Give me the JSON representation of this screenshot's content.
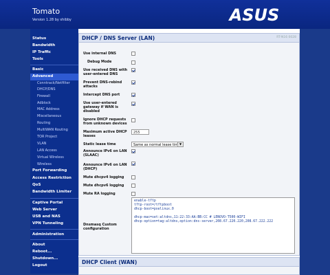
{
  "app": {
    "title": "Tomato",
    "version": "Version 1.28 by shibby",
    "brand": "ASUS",
    "build": "RT-N16 0028"
  },
  "sidebar": {
    "group1": [
      "Status",
      "Bandwidth",
      "IP Traffic",
      "Tools"
    ],
    "basic": "Basic",
    "advanced": "Advanced",
    "advanced_items": [
      "Conntrack/Netfilter",
      "DHCP/DNS",
      "Firewall",
      "Adblock",
      "MAC Address",
      "Miscellaneous",
      "Routing",
      "MultiWAN Routing",
      "TOR Project",
      "VLAN",
      "LAN Access",
      "Virtual Wireless",
      "Wireless"
    ],
    "group2": [
      "Port Forwarding",
      "Access Restriction",
      "QoS",
      "Bandwidth Limiter"
    ],
    "group3": [
      "Captive Portal",
      "Web Server",
      "USB and NAS",
      "VPN Tunneling"
    ],
    "administration": "Administration",
    "group4": [
      "About",
      "Reboot...",
      "Shutdown...",
      "Logout"
    ]
  },
  "dhcp_server": {
    "title": "DHCP / DNS Server (LAN)",
    "fields": [
      {
        "label": "Use internal DNS",
        "checked": false
      },
      {
        "label": "Debug Mode",
        "checked": false
      },
      {
        "label": "Use received DNS with user-entered DNS",
        "checked": true
      },
      {
        "label": "Prevent DNS-rebind attacks",
        "checked": true
      },
      {
        "label": "Intercept DNS port",
        "checked": true
      },
      {
        "label": "Use user-entered gateway if WAN is disabled",
        "checked": true
      },
      {
        "label": "Ignore DHCP requests from unknown devices",
        "checked": false
      }
    ],
    "max_leases_label": "Maximum active DHCP leases",
    "max_leases_value": "255",
    "static_lease_label": "Static lease time",
    "static_lease_value": "Same as normal lease time",
    "fields2": [
      {
        "label": "Announce IPv6 on LAN (SLAAC)",
        "checked": true
      },
      {
        "label": "Announce IPv6 on LAN (DHCP)",
        "checked": true
      },
      {
        "label": "Mute dhcpv4 logging",
        "checked": false
      },
      {
        "label": "Mute dhcpv6 logging",
        "checked": false
      },
      {
        "label": "Mute RA logging",
        "checked": false
      }
    ],
    "dnsmasq_label": "Dnsmasq Custom configuration",
    "dnsmasq_lines": [
      "enable-tftp",
      "tftp-root=/tftpboot",
      "dhcp-boot=pxelinux.0",
      "",
      "dhcp-mac=set:altdns,11:22:33:AA:BB:CC # LENOVO-T500-WIFI",
      "dhcp-option=tag:altdns,option:dns-server,208.67.220.220,208.67.222.222"
    ]
  },
  "dhcp_client": {
    "title": "DHCP Client (WAN)"
  }
}
